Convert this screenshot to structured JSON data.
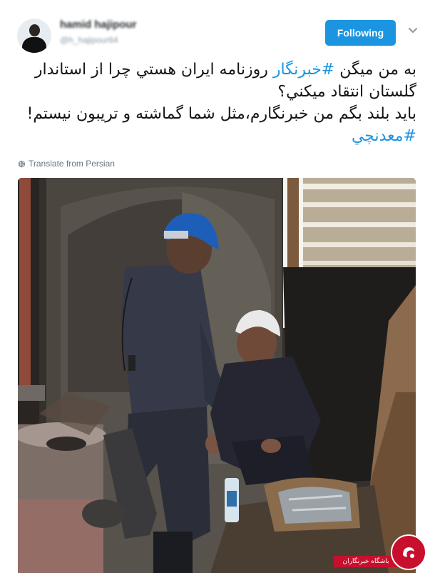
{
  "tweet": {
    "author": {
      "display_name": "hamid hajipour",
      "handle": "@h_hajipour64"
    },
    "follow_button": {
      "label": "Following"
    },
    "text": {
      "line1_before": "به من میگن ",
      "line1_hashtag": "#خبرنگار",
      "line1_after": " روزنامه ایران هستي چرا از استاندار",
      "line2": "گلستان انتقاد میکني؟",
      "line3": "باید بلند بگم من خبرنگارم،مثل شما گماشته و تریبون نیستم!",
      "line4_hashtag": "#معدنچي"
    },
    "translate_label": "Translate from Persian",
    "accent_color": "#1b95e0"
  },
  "watermark": {
    "label": "باشگاه خبرنگاران",
    "color": "#c8102e"
  },
  "icons": [
    "caret-down-icon",
    "globe-icon",
    "watermark-logo-icon"
  ]
}
